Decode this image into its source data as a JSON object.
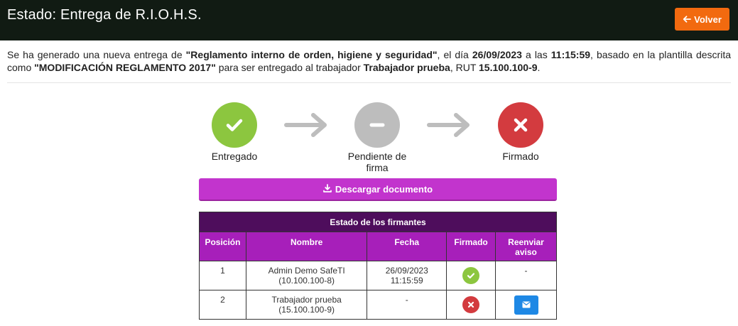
{
  "header": {
    "title": "Estado: Entrega de R.I.O.H.S.",
    "back_label": "Volver",
    "background_color": "#111b13",
    "back_color": "#f26a0f"
  },
  "description": {
    "part1": "Se ha generado una nueva entrega de ",
    "document_name": "\"Reglamento interno de orden, higiene y seguridad\"",
    "part2": ", el día ",
    "date": "26/09/2023",
    "part3": " a las ",
    "time": "11:15:59",
    "part4": ", basado en la plantilla descrita como ",
    "template_name": "\"MODIFICACIÓN REGLAMENTO 2017\"",
    "part5": " para ser entregado al trabajador ",
    "worker_name": "Trabajador prueba",
    "part6": ", RUT ",
    "worker_rut": "15.100.100-9",
    "part7": "."
  },
  "progress": {
    "steps": [
      {
        "label": "Entregado",
        "status": "done",
        "icon": "check-icon",
        "color": "#8cc63f"
      },
      {
        "label": "Pendiente de firma",
        "status": "pending",
        "icon": "minus-icon",
        "color": "#bdbdbd"
      },
      {
        "label": "Firmado",
        "status": "failed",
        "icon": "x-icon",
        "color": "#d33b3f"
      }
    ],
    "arrow_icon": "arrow-right-icon",
    "arrow_color": "#bdbdbd"
  },
  "download": {
    "label": "Descargar documento",
    "icon": "download-icon",
    "color": "#c234cd"
  },
  "signers_table": {
    "caption": "Estado de los firmantes",
    "columns": [
      "Posición",
      "Nombre",
      "Fecha",
      "Firmado",
      "Reenviar aviso"
    ],
    "rows": [
      {
        "position": "1",
        "name": "Admin Demo SafeTI",
        "rut": "(10.100.100-8)",
        "date": "26/09/2023",
        "time": "11:15:59",
        "signed": "check-icon",
        "resend": "-"
      },
      {
        "position": "2",
        "name": "Trabajador prueba",
        "rut": "(15.100.100-9)",
        "date": "-",
        "time": "",
        "signed": "x-icon",
        "resend": "envelope-icon"
      }
    ],
    "caption_color": "#4e0d5c",
    "header_color": "#a71fba",
    "ok_color": "#8cc63f",
    "fail_color": "#d33b3f",
    "resend_color": "#1e88e5"
  }
}
